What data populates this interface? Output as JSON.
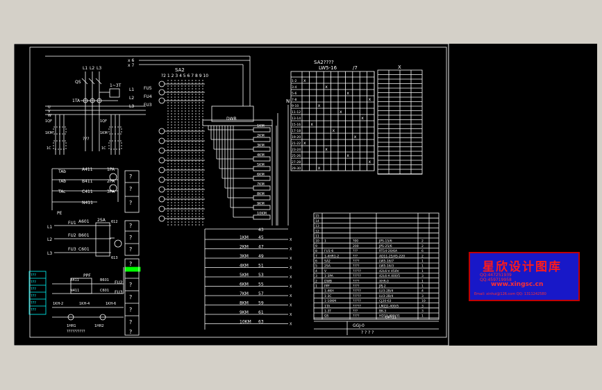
{
  "sheet_labels": {
    "top_feed": [
      "x 6",
      "x 7"
    ],
    "sa2": "SA2",
    "sa2_numbers": "?2 1 2 3 4 5 6 7 8 9 10",
    "dwb": "DWB",
    "phases": [
      "L1",
      "L2",
      "L3"
    ],
    "qs": "QS",
    "one_3t": "1~3T",
    "ta": "1TA",
    "ct_left": [
      "1QF",
      "1KM",
      "1C"
    ],
    "ct_right": [
      "1QF",
      "1KM",
      "1C"
    ],
    "ct_mid": "???",
    "fus": [
      "FU5",
      "FU4",
      "FU3"
    ],
    "l_inputs": [
      "L1",
      "L2",
      "L3"
    ],
    "n_label": "N",
    "uvw": [
      "U",
      "V",
      "W"
    ],
    "meter_rows": [
      {
        "a": "TAb",
        "b": "A411",
        "c": "1PA"
      },
      {
        "a": "TAb",
        "b": "B411",
        "c": "2PA"
      },
      {
        "a": "TAc",
        "b": "C411",
        "c": "3PA"
      },
      {
        "a": "",
        "b": "N411",
        "c": ""
      }
    ],
    "pe": "PE",
    "volt_rows": [
      {
        "l": "L1",
        "fu": "FU1",
        "w": "A601",
        "t": "2SA"
      },
      {
        "l": "L2",
        "fu": "FU2",
        "w": "B601",
        "t": ""
      },
      {
        "l": "L3",
        "fu": "FU3",
        "w": "C601",
        "t": ""
      }
    ],
    "volt_side": [
      "612",
      "613"
    ],
    "ppf": "PPF",
    "ppf_wires": [
      "A411",
      "B601",
      "N411",
      "C601"
    ],
    "fu_right": [
      "FU2",
      "FU3"
    ],
    "bottom_row": [
      "1KH-2",
      "1KH-4",
      "1KH-6"
    ],
    "hr": [
      "1HR1",
      "1HR2"
    ],
    "hr_caption": "??????????",
    "q_marks": [
      "?",
      "?",
      "?",
      "?",
      "?",
      "?",
      "?",
      "?",
      "?",
      "?",
      "?",
      "?"
    ],
    "km_small": [
      "1KM",
      "2KM",
      "3KM",
      "4KM",
      "5KM",
      "6KM",
      "7KM",
      "8KM",
      "9KM",
      "10KM"
    ],
    "km_list": [
      {
        "name": "1KM",
        "num": "45"
      },
      {
        "name": "2KM",
        "num": "47"
      },
      {
        "name": "3KM",
        "num": "49"
      },
      {
        "name": "4KM",
        "num": "51"
      },
      {
        "name": "5KM",
        "num": "53"
      },
      {
        "name": "6KM",
        "num": "55"
      },
      {
        "name": "7KM",
        "num": "57"
      },
      {
        "name": "8KM",
        "num": "59"
      },
      {
        "name": "9KM",
        "num": "61"
      },
      {
        "name": "10KM",
        "num": "63"
      }
    ],
    "km_top_num": "43",
    "x_mark": "X",
    "sa_title": "SA2????",
    "lw_title": "LW5-16",
    "lw_sub": "/7",
    "lw_rows": [
      "1-2",
      "3-4",
      "5-6",
      "7-8",
      "9-10",
      "11-12",
      "13-14",
      "15-16",
      "17-18",
      "19-20",
      "21-22",
      "23-24",
      "25-26",
      "27-28",
      "29-30"
    ],
    "x_table_title": "X",
    "parts_table": [
      {
        "n": "15",
        "a": "",
        "b": "",
        "c": "",
        "q": ""
      },
      {
        "n": "14",
        "a": "",
        "b": "",
        "c": "",
        "q": ""
      },
      {
        "n": "13",
        "a": "",
        "b": "",
        "c": "",
        "q": ""
      },
      {
        "n": "12",
        "a": "",
        "b": "",
        "c": "",
        "q": ""
      },
      {
        "n": "11",
        "a": "",
        "b": "",
        "c": "",
        "q": ""
      },
      {
        "n": "10",
        "a": "1",
        "b": "?00",
        "c": "JPS-15/6",
        "q": "2"
      },
      {
        "n": "9",
        "a": "",
        "b": "200",
        "c": "JPS-25/6",
        "q": "2"
      },
      {
        "n": "8",
        "a": "FU1-6",
        "b": "???",
        "c": "RT14-20/6A",
        "q": "6"
      },
      {
        "n": "7",
        "a": "1-4HR1-2",
        "b": "???",
        "c": "AD11-25/45-220",
        "q": "2"
      },
      {
        "n": "6",
        "a": "SA2",
        "b": "????",
        "c": "LW5-16/7",
        "q": "1"
      },
      {
        "n": "5",
        "a": "2SA",
        "b": "????",
        "c": "LW5-16/3",
        "q": "1"
      },
      {
        "n": "4",
        "a": "V",
        "b": "?????",
        "c": "42L6-V 450V",
        "q": "1"
      },
      {
        "n": "3",
        "a": "1-3PA",
        "b": "?????",
        "c": "42L6-A 400/5",
        "q": "3"
      },
      {
        "n": "2",
        "a": "DWB",
        "b": "????",
        "c": "XHR-0",
        "q": "1"
      },
      {
        "n": "1",
        "a": "PPF",
        "b": "????",
        "c": "JPJ-2",
        "q": "1"
      },
      {
        "n": "",
        "a": "1-4KH",
        "b": "?????",
        "c": "LU3-2B/4",
        "q": "4"
      },
      {
        "n": "",
        "a": "1-3C",
        "b": "?????",
        "c": "LU3-2B/4",
        "q": "3"
      },
      {
        "n": "",
        "a": "1-10KM",
        "b": "?????",
        "c": "CJ20-63",
        "q": "10"
      },
      {
        "n": "",
        "a": "1TA",
        "b": "?????",
        "c": "LMZJ1-400/5",
        "q": "3"
      },
      {
        "n": "",
        "a": "1-3T",
        "b": "???",
        "c": "BK-3",
        "q": "3"
      },
      {
        "n": "",
        "a": "QS",
        "b": "????",
        "c": "HD13-400/31",
        "q": "1"
      }
    ],
    "title_block": {
      "code": "DP?11",
      "drawing": "GGJ-0",
      "marks": "? ? ? ?"
    },
    "left_stamp": [
      "???",
      "???",
      "???",
      "???",
      "???",
      "???"
    ]
  },
  "logo": {
    "title": "星欣设计图库",
    "qq1": "QQ:447251939",
    "qq2": "QQ:459719958",
    "url": "www.xingsc.cn",
    "email": "Email: xinhui@126.com  QQ:  1311242580"
  },
  "colors": {
    "background": "#000000",
    "line": "#ffffff",
    "accent": "#00ffff",
    "highlight": "#00ff00",
    "logo_bg": "#1818c8",
    "logo_text": "#ff1a1a"
  }
}
